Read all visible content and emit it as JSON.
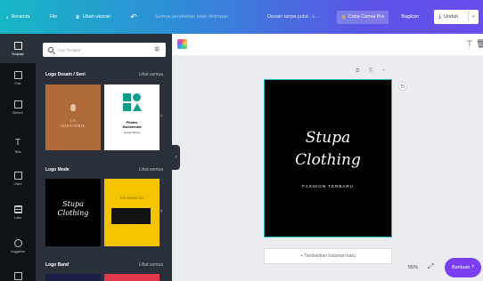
{
  "topbar": {
    "back_label": "Beranda",
    "file_label": "File",
    "resize_label": "Ubah ukuran",
    "undo_icon": "undo-icon",
    "saved_status": "Semua perubahan telah disimpan",
    "doc_title": "Desain tanpa judul - L...",
    "pro_label": "Coba Canva Pro",
    "share_label": "Bagikan",
    "download_label": "Unduh"
  },
  "rail": {
    "items": [
      {
        "label": "Template",
        "icon": "template-icon"
      },
      {
        "label": "Foto",
        "icon": "photo-icon"
      },
      {
        "label": "Elemen",
        "icon": "elements-icon"
      },
      {
        "label": "Teks",
        "icon": "text-icon"
      },
      {
        "label": "Video",
        "icon": "video-icon"
      },
      {
        "label": "Latar",
        "icon": "background-icon"
      },
      {
        "label": "Unggahan",
        "icon": "upload-icon"
      },
      {
        "label": "",
        "icon": "folder-icon"
      }
    ]
  },
  "panel": {
    "search_placeholder": "Cari Templat",
    "sections": [
      {
        "title": "Logo Desain / Seni",
        "link": "Lihat semua",
        "thumbs": [
          {
            "line1": "LA",
            "line2": "IMPAGERIE"
          },
          {
            "line1": "Pilates",
            "line2": "Multimedia",
            "line3": "Desain Brand"
          }
        ]
      },
      {
        "title": "Logo Mode",
        "link": "Lihat semua",
        "thumbs": [
          {
            "line1": "Stupa",
            "line2": "Clothing"
          },
          {
            "line1": "THE BRAND CO."
          }
        ]
      },
      {
        "title": "Logo Band",
        "link": "Lihat semua"
      }
    ]
  },
  "canvas": {
    "line1": "Stupa",
    "line2": "Clothing",
    "tagline": "FASHION TERBARU",
    "add_page_label": "+ Tambahkan halaman baru"
  },
  "footer": {
    "zoom": "55%",
    "help_label": "Bantuan ?"
  },
  "colors": {
    "topbar_start": "#16b7c4",
    "topbar_end": "#6a4ded",
    "help_button": "#7b3ff2",
    "canvas_border": "#16b7c4"
  }
}
